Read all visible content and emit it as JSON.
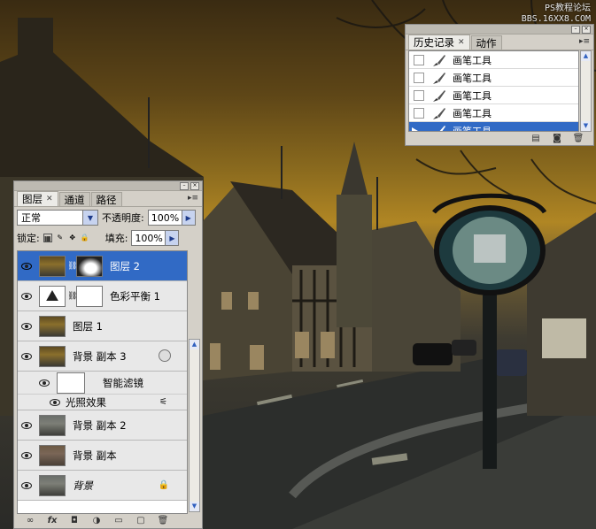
{
  "watermark": {
    "line1": "PS教程论坛",
    "line2": "BBS.16XX8.COM"
  },
  "history_panel": {
    "tabs": [
      {
        "label": "历史记录",
        "active": true
      },
      {
        "label": "动作",
        "active": false
      }
    ],
    "items": [
      {
        "label": "画笔工具",
        "selected": false
      },
      {
        "label": "画笔工具",
        "selected": false
      },
      {
        "label": "画笔工具",
        "selected": false
      },
      {
        "label": "画笔工具",
        "selected": false
      },
      {
        "label": "画笔工具",
        "selected": true
      }
    ],
    "footer_icons": [
      "new-document-from-state-icon",
      "snapshot-camera-icon",
      "trash-icon"
    ]
  },
  "layers_panel": {
    "tabs": [
      {
        "label": "图层",
        "active": true
      },
      {
        "label": "通道",
        "active": false
      },
      {
        "label": "路径",
        "active": false
      }
    ],
    "blend_mode": "正常",
    "opacity_label": "不透明度:",
    "opacity_value": "100%",
    "lock_label": "锁定:",
    "fill_label": "填充:",
    "fill_value": "100%",
    "layers": [
      {
        "name": "图层 2",
        "selected": true
      },
      {
        "name": "色彩平衡 1",
        "selected": false
      },
      {
        "name": "图层 1",
        "selected": false
      },
      {
        "name": "背景 副本 3",
        "selected": false
      },
      {
        "name": "智能滤镜",
        "selected": false
      },
      {
        "name": "光照效果",
        "selected": false
      },
      {
        "name": "背景 副本 2",
        "selected": false
      },
      {
        "name": "背景 副本",
        "selected": false
      },
      {
        "name": "背景",
        "selected": false
      }
    ],
    "footer_icons": [
      "link-icon",
      "fx-icon",
      "mask-icon",
      "adjustment-icon",
      "group-folder-icon",
      "new-layer-icon",
      "trash-icon"
    ]
  },
  "colors": {
    "selection": "#316ac5",
    "panel_bg": "#d4d0c8"
  }
}
